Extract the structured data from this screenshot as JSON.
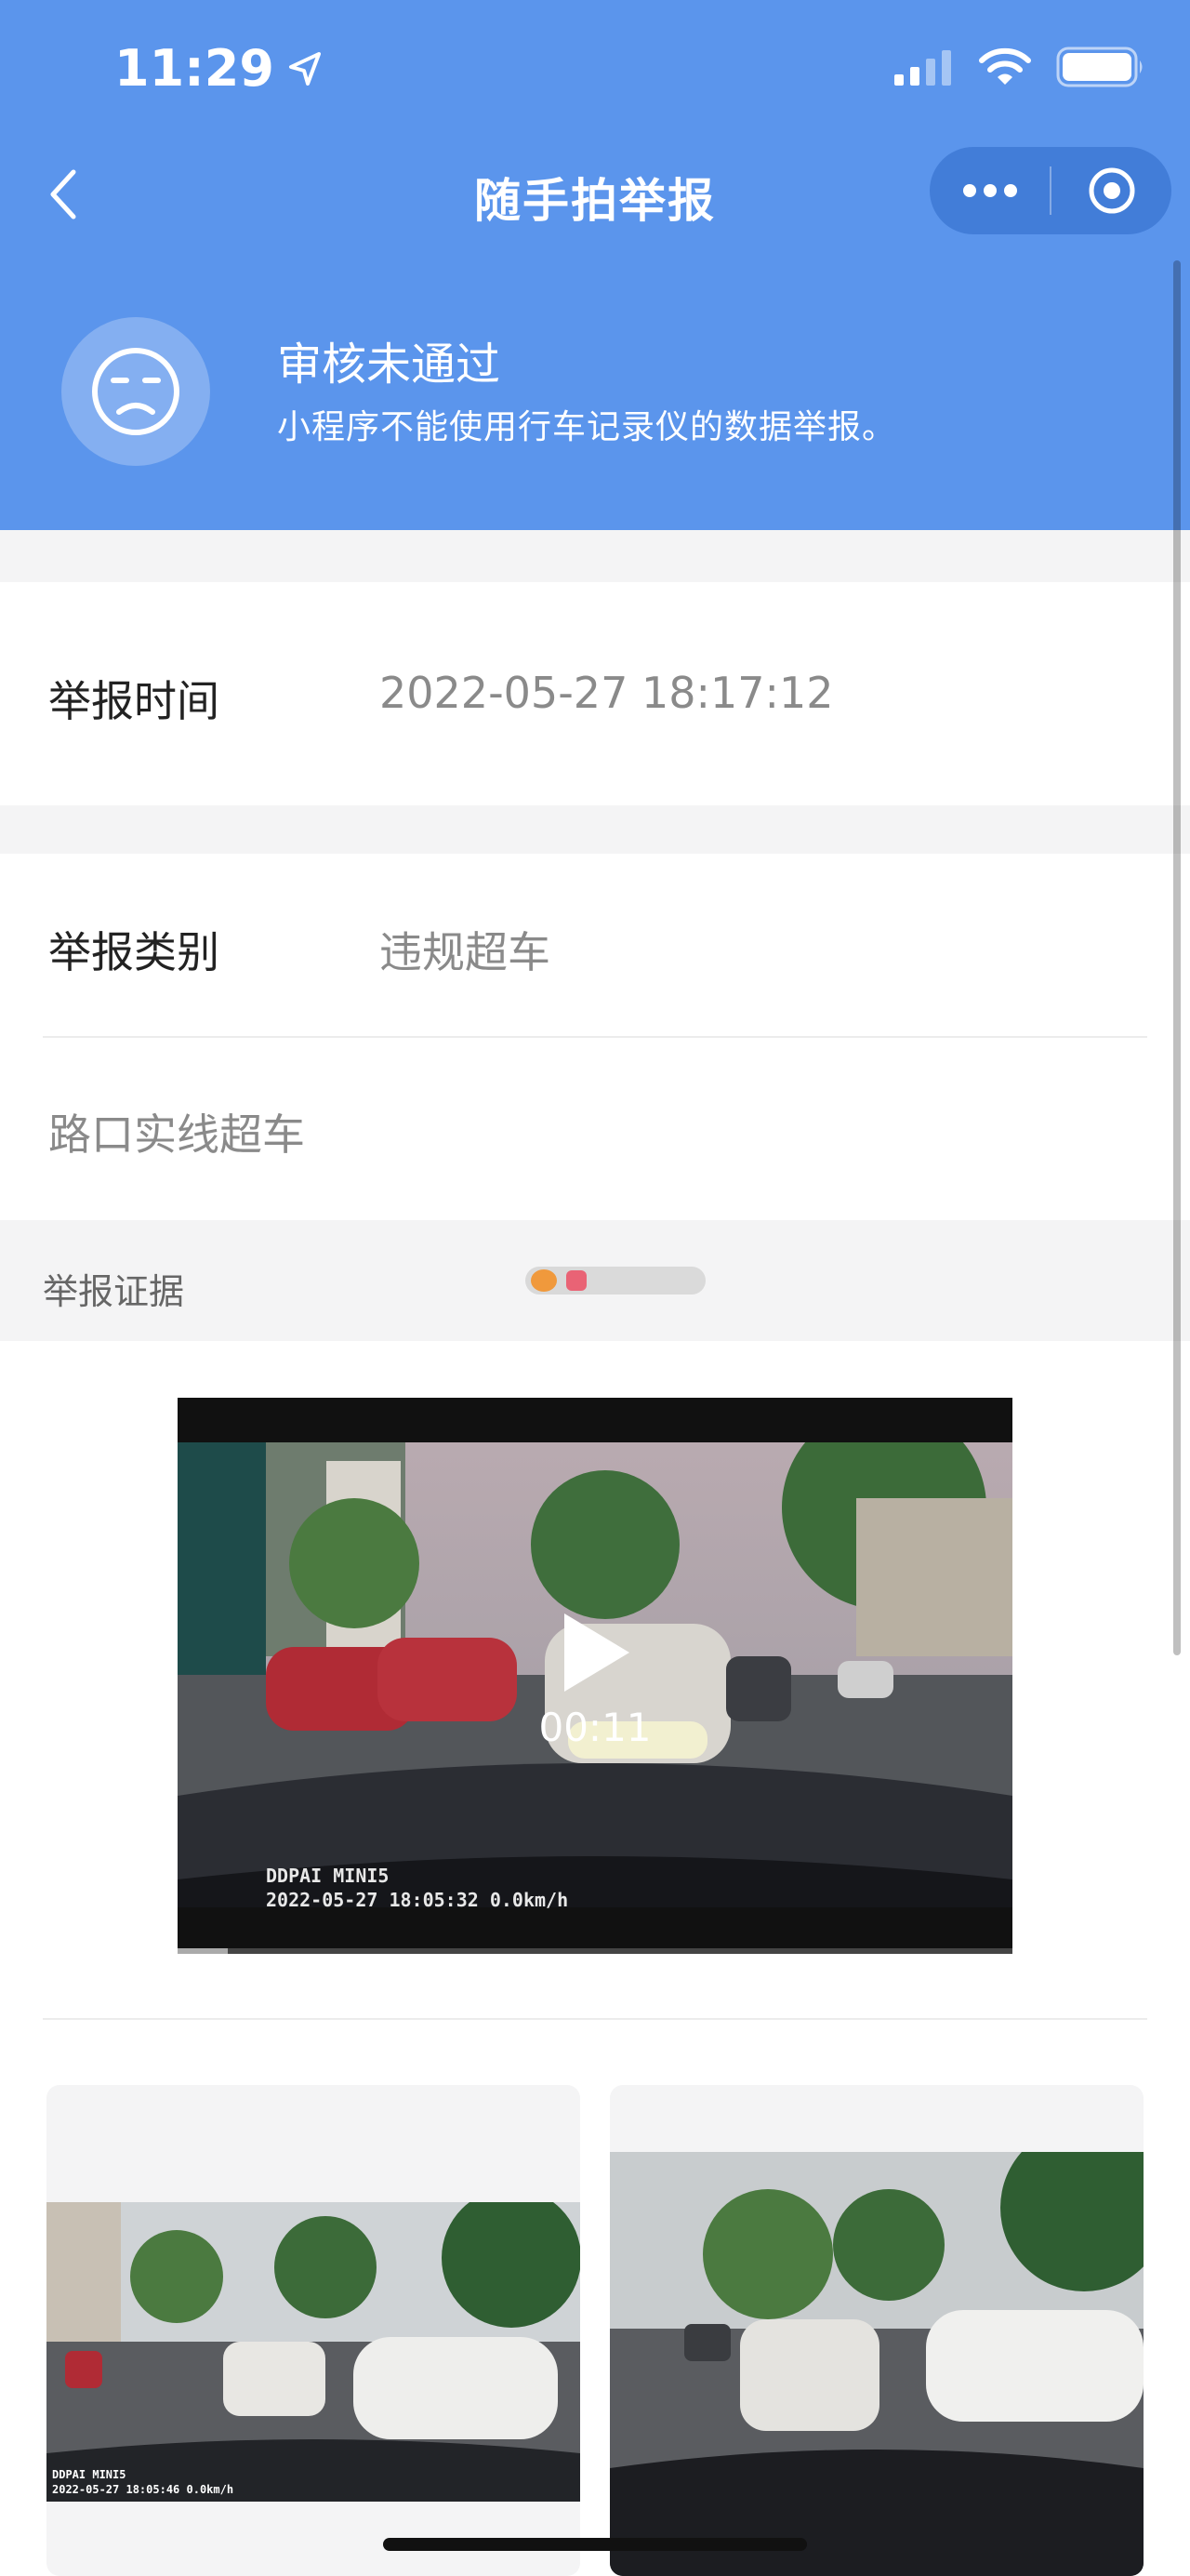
{
  "status_bar": {
    "time": "11:29",
    "icons": [
      "location-arrow-icon",
      "signal-icon",
      "wifi-icon",
      "battery-icon"
    ]
  },
  "nav": {
    "title": "随手拍举报",
    "back_icon": "back-chevron-icon",
    "more_icon": "more-dots-icon",
    "close_icon": "target-circle-icon"
  },
  "audit": {
    "icon": "frown-face-icon",
    "title": "审核未通过",
    "message": "小程序不能使用行车记录仪的数据举报。"
  },
  "report": {
    "time_label": "举报时间",
    "time_value": "2022-05-27 18:17:12",
    "category_label": "举报类别",
    "category_value": "违规超车",
    "description": "路口实线超车"
  },
  "evidence": {
    "label": "举报证据",
    "video": {
      "duration": "00:11",
      "osd_brand": "DDPAI MINI5",
      "osd_info": "2022-05-27 18:05:32  0.0km/h",
      "progress": 0.06
    },
    "photos": [
      {
        "osd_brand": "DDPAI MINI5",
        "osd_info": "2022-05-27 18:05:46  0.0km/h"
      },
      {
        "osd_brand": "",
        "osd_info": ""
      }
    ]
  },
  "colors": {
    "header_bg": "#5b95ec",
    "section_gap": "#f4f4f5",
    "label_text": "#222222",
    "value_text": "#8a8a8a"
  }
}
